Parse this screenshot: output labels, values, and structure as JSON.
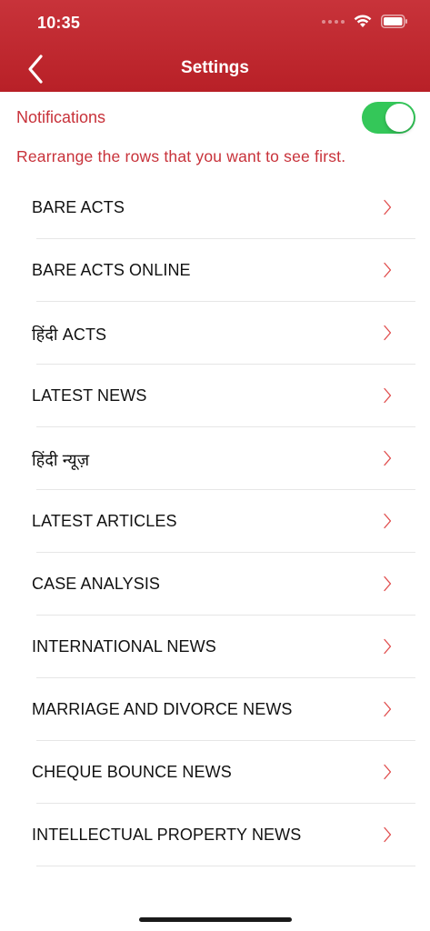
{
  "status_bar": {
    "time": "10:35"
  },
  "nav": {
    "title": "Settings",
    "back_icon": "chevron-left-icon"
  },
  "notifications": {
    "label": "Notifications",
    "enabled": true
  },
  "hint": "Rearrange the rows that you want to see first.",
  "rows": [
    {
      "label": "BARE ACTS"
    },
    {
      "label": "BARE ACTS ONLINE"
    },
    {
      "label": "हिंदी ACTS"
    },
    {
      "label": "LATEST NEWS"
    },
    {
      "label": "हिंदी न्यूज़"
    },
    {
      "label": "LATEST ARTICLES"
    },
    {
      "label": "CASE ANALYSIS"
    },
    {
      "label": "INTERNATIONAL NEWS"
    },
    {
      "label": "MARRIAGE AND DIVORCE NEWS"
    },
    {
      "label": "CHEQUE BOUNCE NEWS"
    },
    {
      "label": "INTELLECTUAL PROPERTY NEWS"
    }
  ],
  "colors": {
    "header": "#b82027",
    "accent_text": "#c8323a",
    "toggle_on": "#34c759",
    "chevron": "#e04b4b"
  }
}
